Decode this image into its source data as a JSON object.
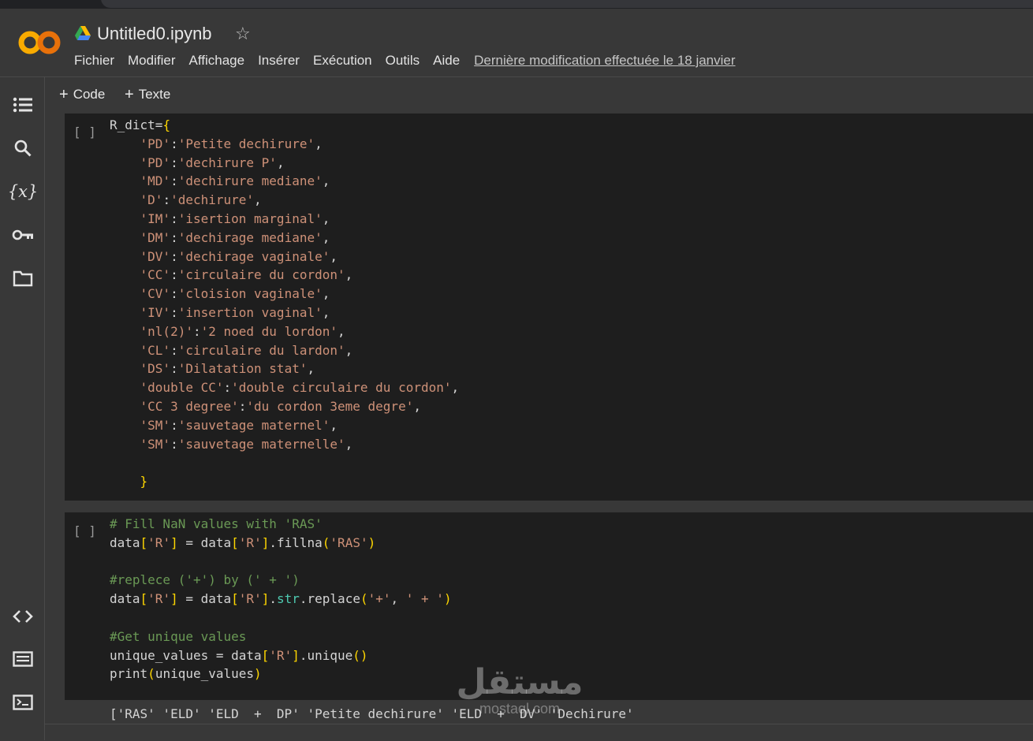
{
  "app": {
    "notebook_title": "Untitled0.ipynb",
    "logo_text": "CO"
  },
  "menu": {
    "items": [
      "Fichier",
      "Modifier",
      "Affichage",
      "Insérer",
      "Exécution",
      "Outils",
      "Aide"
    ],
    "last_edit": "Dernière modification effectuée le 18 janvier"
  },
  "toolbar": {
    "code_label": "Code",
    "text_label": "Texte"
  },
  "sidebar": {
    "icons": [
      "table-of-contents-icon",
      "search-icon",
      "variables-icon",
      "secrets-key-icon",
      "files-folder-icon",
      "code-snippets-icon",
      "command-palette-icon",
      "terminal-icon"
    ]
  },
  "cells": [
    {
      "run_label": "[ ]",
      "lines": [
        "R_dict={",
        "    'PD':'Petite dechirure',",
        "    'PD':'dechirure P',",
        "    'MD':'dechirure mediane',",
        "    'D':'dechirure',",
        "    'IM':'isertion marginal',",
        "    'DM':'dechirage mediane',",
        "    'DV':'dechirage vaginale',",
        "    'CC':'circulaire du cordon',",
        "    'CV':'cloision vaginale',",
        "    'IV':'insertion vaginal',",
        "    'nl(2)':'2 noed du lordon',",
        "    'CL':'circulaire du lardon',",
        "    'DS':'Dilatation stat',",
        "    'double CC':'double circulaire du cordon',",
        "    'CC 3 degree':'du cordon 3eme degre',",
        "    'SM':'sauvetage maternel',",
        "    'SM':'sauvetage maternelle',",
        "",
        "    }"
      ]
    },
    {
      "run_label": "[ ]",
      "lines": [
        "# Fill NaN values with 'RAS'",
        "data['R'] = data['R'].fillna('RAS')",
        "",
        "#replece ('+') by (' + ')",
        "data['R'] = data['R'].str.replace('+', ' + ')",
        "",
        "#Get unique values",
        "unique_values = data['R'].unique()",
        "print(unique_values)"
      ],
      "output": "['RAS' 'ELD' 'ELD  +  DP' 'Petite dechirure' 'ELD  +  DV' 'Dechirure'"
    }
  ],
  "watermark": {
    "arabic": "مستقل",
    "latin": "mostaql.com"
  },
  "colors": {
    "background": "#383838",
    "cell_bg": "#1e1e1e",
    "string": "#ce9178",
    "comment": "#6a9955",
    "bracket": "#ffd700",
    "method": "#4ec9b0"
  }
}
